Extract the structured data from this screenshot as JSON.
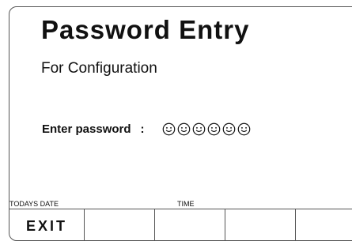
{
  "screen": {
    "title": "Password Entry",
    "subtitle": "For Configuration"
  },
  "password": {
    "label": "Enter password",
    "separator": ":",
    "entered_count": 6,
    "char_icon": "smiley-icon"
  },
  "status": {
    "date_label": "TODAYS DATE",
    "time_label": "TIME"
  },
  "softkeys": [
    {
      "label": "EXIT"
    },
    {
      "label": ""
    },
    {
      "label": ""
    },
    {
      "label": ""
    },
    {
      "label": ""
    }
  ]
}
